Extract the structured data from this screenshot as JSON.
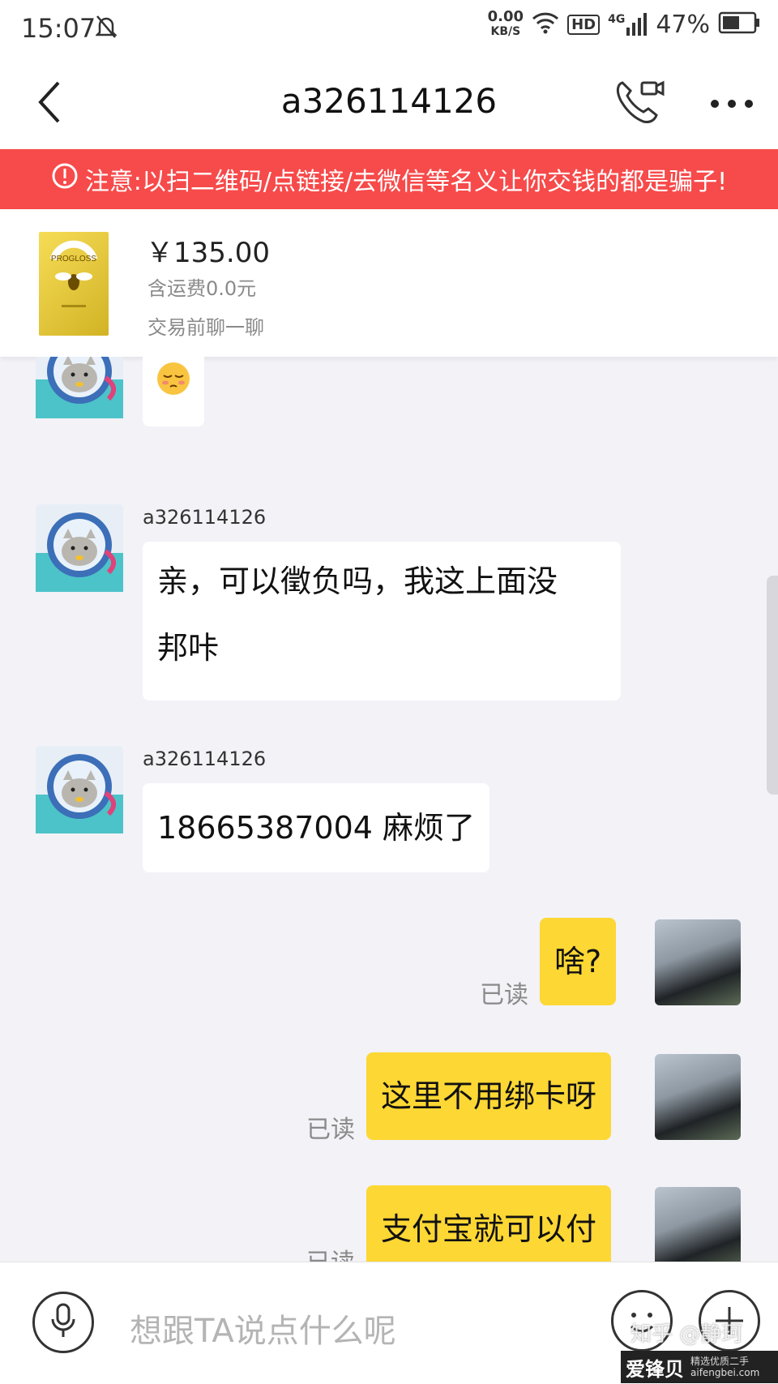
{
  "status_bar": {
    "time": "15:07",
    "net_speed": "0.00",
    "net_unit": "KB/S",
    "hd": "HD",
    "signal": "4G",
    "battery": "47%"
  },
  "header": {
    "title": "a326114126"
  },
  "warning": {
    "text": "注意:以扫二维码/点链接/去微信等名义让你交钱的都是骗子!"
  },
  "product": {
    "price": "￥135.00",
    "shipping": "含运费0.0元",
    "note": "交易前聊一聊",
    "label": "PROGLOSS"
  },
  "messages": [
    {
      "from": "other",
      "content": "emoji"
    },
    {
      "from": "other",
      "sender": "a326114126",
      "lines": [
        "亲，可以徵负吗，我这上面没",
        "邦咔"
      ]
    },
    {
      "from": "other",
      "sender": "a326114126",
      "text": "18665387004 麻烦了"
    },
    {
      "from": "me",
      "text": "啥?",
      "status": "已读"
    },
    {
      "from": "me",
      "text": "这里不用绑卡呀",
      "status": "已读"
    },
    {
      "from": "me",
      "text": "支付宝就可以付",
      "status": "已读"
    }
  ],
  "input": {
    "placeholder": "想跟TA说点什么呢"
  },
  "watermark": {
    "brand": "爱锋贝",
    "tagline": "精选优质二手",
    "url": "aifengbei.com",
    "zhihu": "知乎 @静珂"
  },
  "colors": {
    "warning_bg": "#f74a4a",
    "outgoing_bubble": "#fdd734",
    "chat_bg": "#f2f2f7"
  }
}
